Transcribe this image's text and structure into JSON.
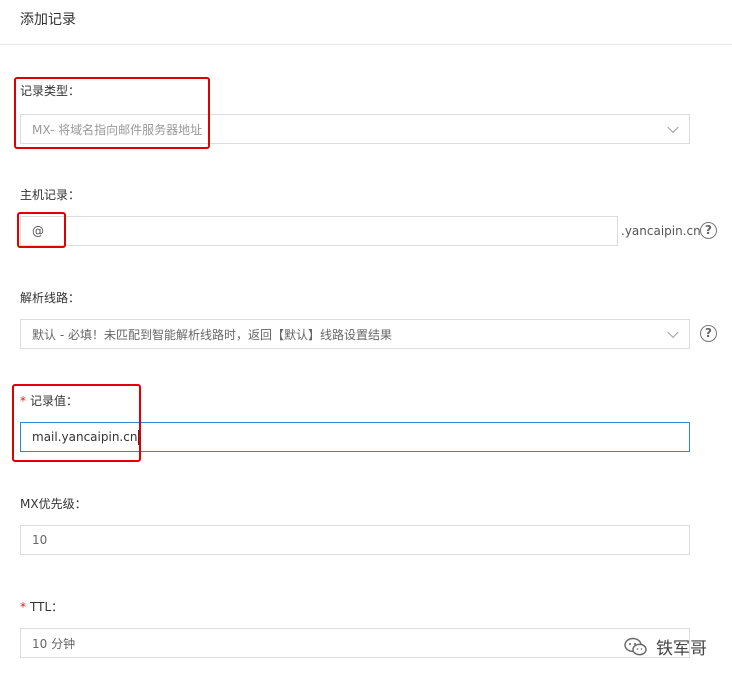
{
  "header": {
    "title": "添加记录"
  },
  "record_type": {
    "label": "记录类型：",
    "value": "MX- 将域名指向邮件服务器地址"
  },
  "host": {
    "label": "主机记录：",
    "value": "@",
    "suffix": ".yancaipin.cn"
  },
  "line": {
    "label": "解析线路：",
    "value": "默认 - 必填！未匹配到智能解析线路时，返回【默认】线路设置结果"
  },
  "record_value": {
    "required_mark": "*",
    "label": "记录值：",
    "value": "mail.yancaipin.cn"
  },
  "mx_priority": {
    "label": "MX优先级：",
    "value": "10"
  },
  "ttl": {
    "required_mark": "*",
    "label": "TTL：",
    "value": "10 分钟"
  },
  "help_icon_glyph": "?",
  "watermark": {
    "text": "铁军哥"
  },
  "colors": {
    "highlight": "#e00000",
    "focus_border": "#2a8ad6",
    "required": "#e02020"
  }
}
